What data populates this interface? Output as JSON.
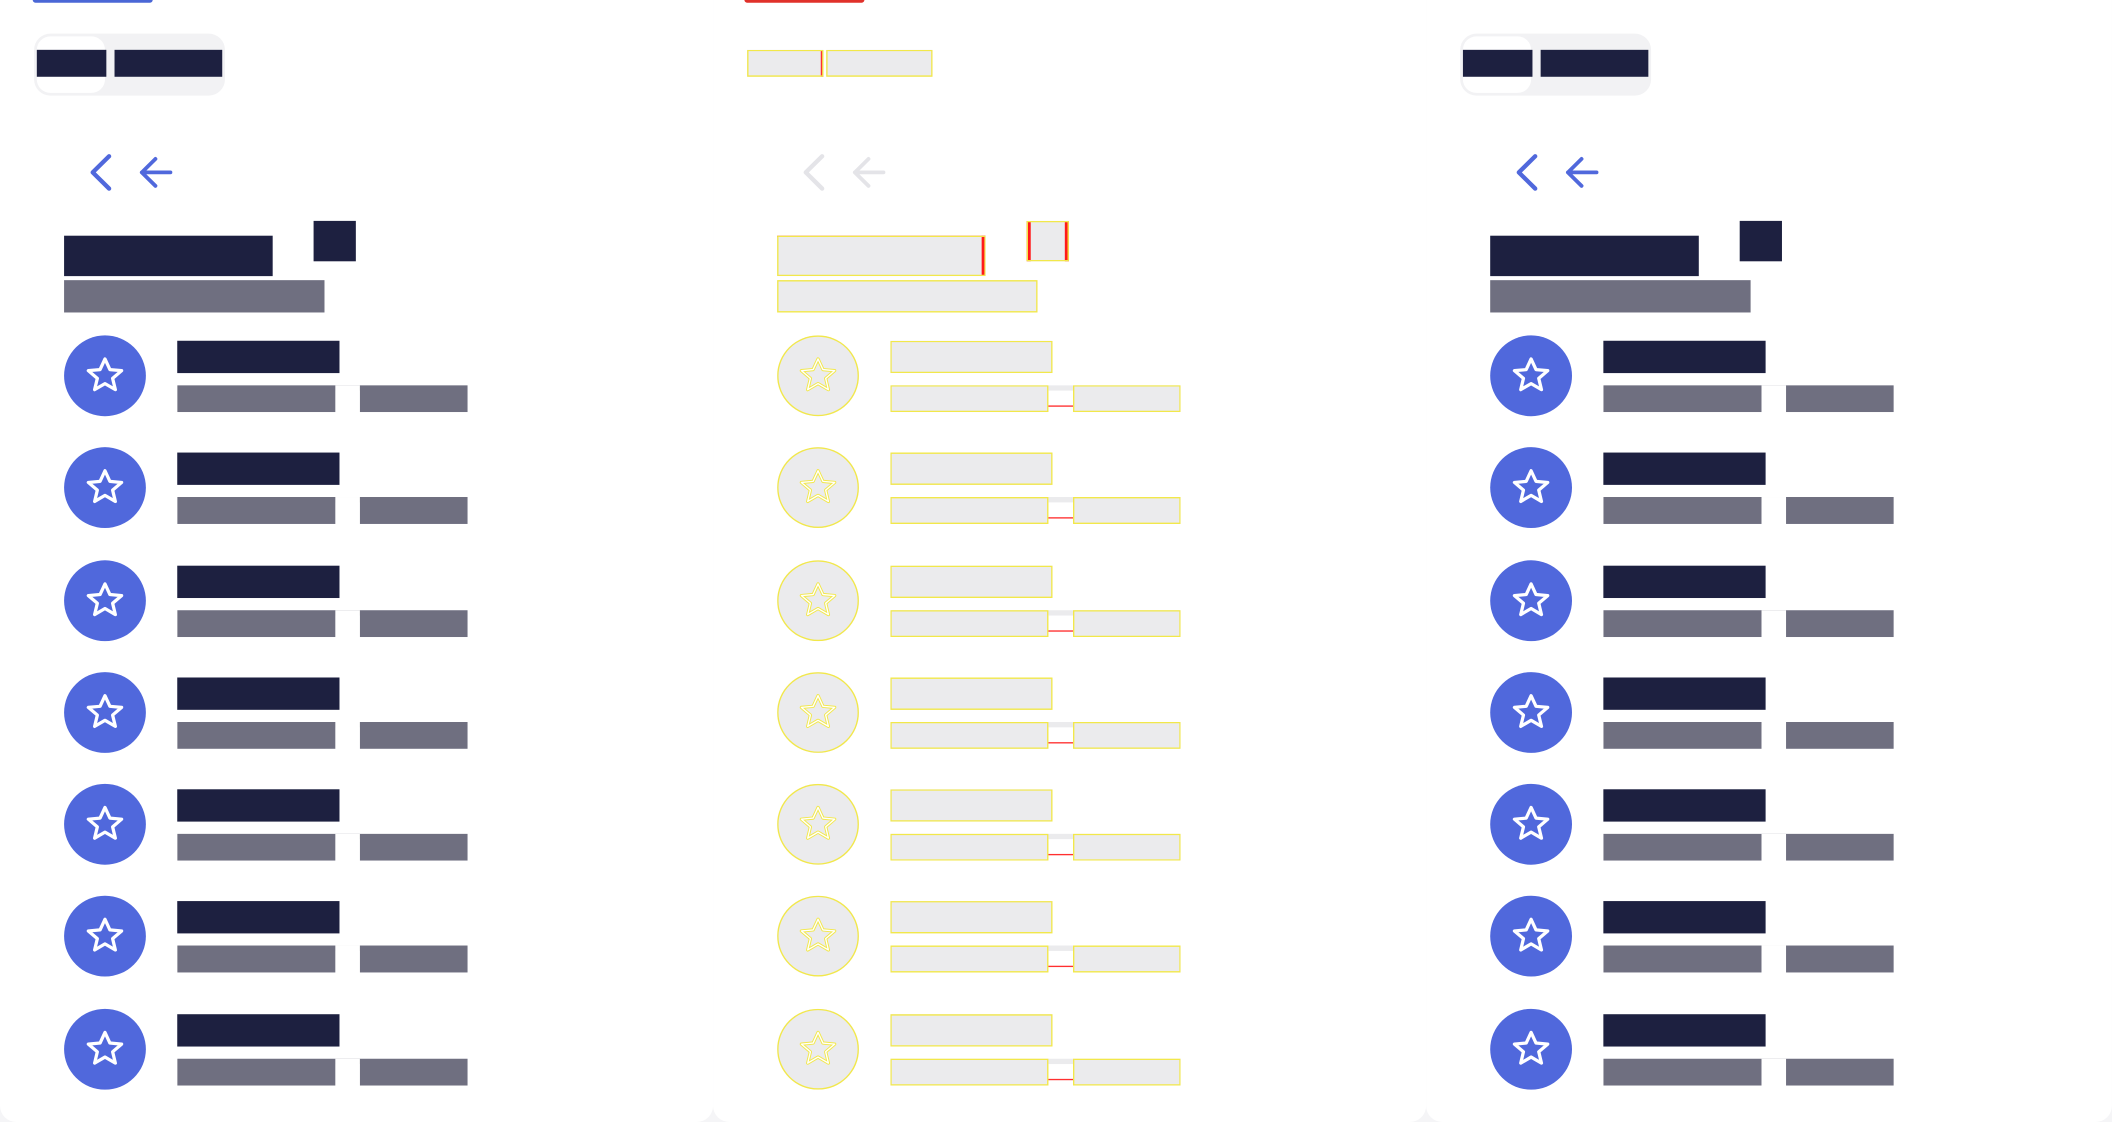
{
  "colors": {
    "accent": "#5068dc",
    "heading": "#1d2040",
    "muted": "#6f6f80",
    "panel": "#ffffff",
    "page_bg": "#f5f5f7",
    "ghost_fill": "#ebebed",
    "ghost_outline": "#f2e84a",
    "ghost_marker": "#ff2a2a",
    "accent_strip_1": "#4a67d6",
    "accent_strip_2": "#e0312a"
  },
  "icons": {
    "nav_back": "chevron-left-icon",
    "nav_arrow": "arrow-left-icon",
    "item": "star-icon"
  },
  "panels": [
    {
      "variant": "solid",
      "segmented": {
        "option_1": "",
        "option_2": ""
      },
      "title": "",
      "title_badge": "",
      "subtitle": "",
      "items": [
        {
          "title": "",
          "subtitle": ""
        },
        {
          "title": "",
          "subtitle": ""
        },
        {
          "title": "",
          "subtitle": ""
        },
        {
          "title": "",
          "subtitle": ""
        },
        {
          "title": "",
          "subtitle": ""
        },
        {
          "title": "",
          "subtitle": ""
        },
        {
          "title": "",
          "subtitle": ""
        }
      ]
    },
    {
      "variant": "ghost",
      "segmented": {
        "option_1": "",
        "option_2": ""
      },
      "title": "",
      "title_badge": "",
      "subtitle": "",
      "items": [
        {
          "title": "",
          "subtitle": ""
        },
        {
          "title": "",
          "subtitle": ""
        },
        {
          "title": "",
          "subtitle": ""
        },
        {
          "title": "",
          "subtitle": ""
        },
        {
          "title": "",
          "subtitle": ""
        },
        {
          "title": "",
          "subtitle": ""
        },
        {
          "title": "",
          "subtitle": ""
        }
      ]
    },
    {
      "variant": "solid",
      "segmented": {
        "option_1": "",
        "option_2": ""
      },
      "title": "",
      "title_badge": "",
      "subtitle": "",
      "items": [
        {
          "title": "",
          "subtitle": ""
        },
        {
          "title": "",
          "subtitle": ""
        },
        {
          "title": "",
          "subtitle": ""
        },
        {
          "title": "",
          "subtitle": ""
        },
        {
          "title": "",
          "subtitle": ""
        },
        {
          "title": "",
          "subtitle": ""
        },
        {
          "title": "",
          "subtitle": ""
        }
      ]
    }
  ]
}
